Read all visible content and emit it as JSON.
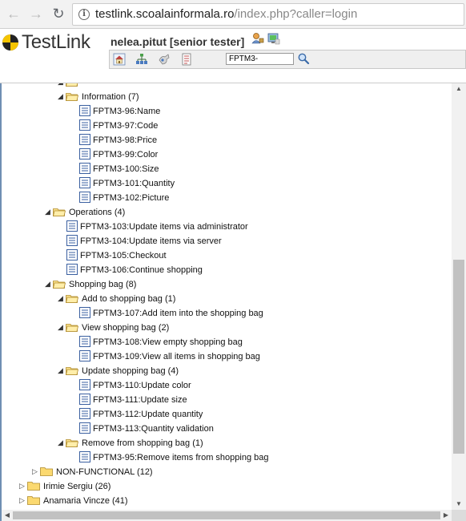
{
  "browser": {
    "url_host": "testlink.scoalainformala.ro",
    "url_path": "/index.php?caller=login"
  },
  "header": {
    "logo_text": "TestLink",
    "user": "nelea.pitut [senior tester]",
    "search_value": "FPTM3-"
  },
  "tree": {
    "nodes": [
      {
        "text": "Information (7)"
      },
      {
        "text": "FPTM3-96:Name"
      },
      {
        "text": "FPTM3-97:Code"
      },
      {
        "text": "FPTM3-98:Price"
      },
      {
        "text": "FPTM3-99:Color"
      },
      {
        "text": "FPTM3-100:Size"
      },
      {
        "text": "FPTM3-101:Quantity"
      },
      {
        "text": "FPTM3-102:Picture"
      },
      {
        "text": "Operations (4)"
      },
      {
        "text": "FPTM3-103:Update items via administrator"
      },
      {
        "text": "FPTM3-104:Update items via server"
      },
      {
        "text": "FPTM3-105:Checkout"
      },
      {
        "text": "FPTM3-106:Continue shopping"
      },
      {
        "text": "Shopping bag (8)"
      },
      {
        "text": "Add to shopping bag (1)"
      },
      {
        "text": "FPTM3-107:Add item into the shopping bag"
      },
      {
        "text": "View shopping bag (2)"
      },
      {
        "text": "FPTM3-108:View empty shopping bag"
      },
      {
        "text": "FPTM3-109:View all items in shopping bag"
      },
      {
        "text": "Update shopping bag (4)"
      },
      {
        "text": "FPTM3-110:Update color"
      },
      {
        "text": "FPTM3-111:Update size"
      },
      {
        "text": "FPTM3-112:Update quantity"
      },
      {
        "text": "FPTM3-113:Quantity validation"
      },
      {
        "text": "Remove from shopping bag (1)"
      },
      {
        "text": "FPTM3-95:Remove items from shopping bag"
      },
      {
        "text": "NON-FUNCTIONAL (12)"
      },
      {
        "text": "Irimie Sergiu (26)"
      },
      {
        "text": "Anamaria Vincze (41)"
      }
    ]
  }
}
